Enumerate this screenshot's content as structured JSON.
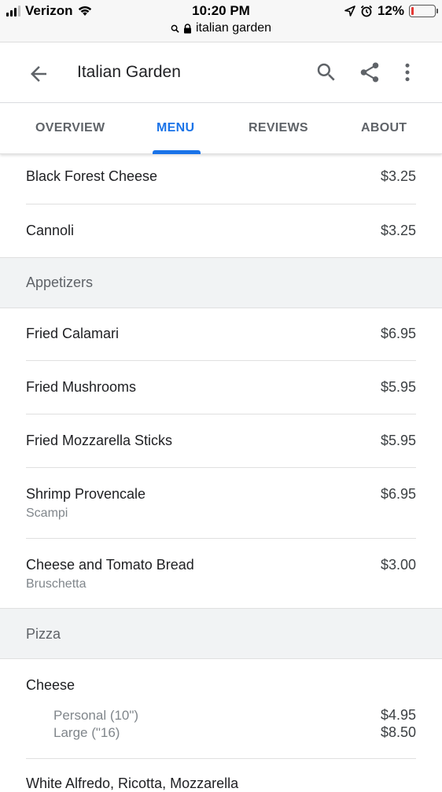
{
  "status_bar": {
    "carrier": "Verizon",
    "time": "10:20 PM",
    "url": "italian garden",
    "battery": "12%",
    "battery_level": 0.12,
    "battery_color": "#e53935"
  },
  "header": {
    "title": "Italian Garden",
    "icons": [
      "back-arrow-icon",
      "search-icon",
      "share-icon",
      "more-vert-icon"
    ]
  },
  "tabs": [
    {
      "label": "OVERVIEW",
      "active": false
    },
    {
      "label": "MENU",
      "active": true
    },
    {
      "label": "REVIEWS",
      "active": false
    },
    {
      "label": "ABOUT",
      "active": false
    }
  ],
  "accent_color": "#1a73e8",
  "menu": {
    "top_items": [
      {
        "name": "Black Forest Cheese",
        "price": "$3.25"
      },
      {
        "name": "Cannoli",
        "price": "$3.25"
      }
    ],
    "sections": [
      {
        "label": "Appetizers",
        "items": [
          {
            "name": "Fried Calamari",
            "price": "$6.95"
          },
          {
            "name": "Fried Mushrooms",
            "price": "$5.95"
          },
          {
            "name": "Fried Mozzarella Sticks",
            "price": "$5.95"
          },
          {
            "name": "Shrimp Provencale",
            "subtitle": "Scampi",
            "price": "$6.95"
          },
          {
            "name": "Cheese and Tomato Bread",
            "subtitle": "Bruschetta",
            "price": "$3.00"
          }
        ]
      },
      {
        "label": "Pizza",
        "items": [
          {
            "name": "Cheese",
            "sizes": [
              {
                "label": "Personal (10\")",
                "price": "$4.95"
              },
              {
                "label": "Large (\"16)",
                "price": "$8.50"
              }
            ]
          },
          {
            "name": "White Alfredo, Ricotta, Mozzarella"
          }
        ]
      }
    ]
  }
}
